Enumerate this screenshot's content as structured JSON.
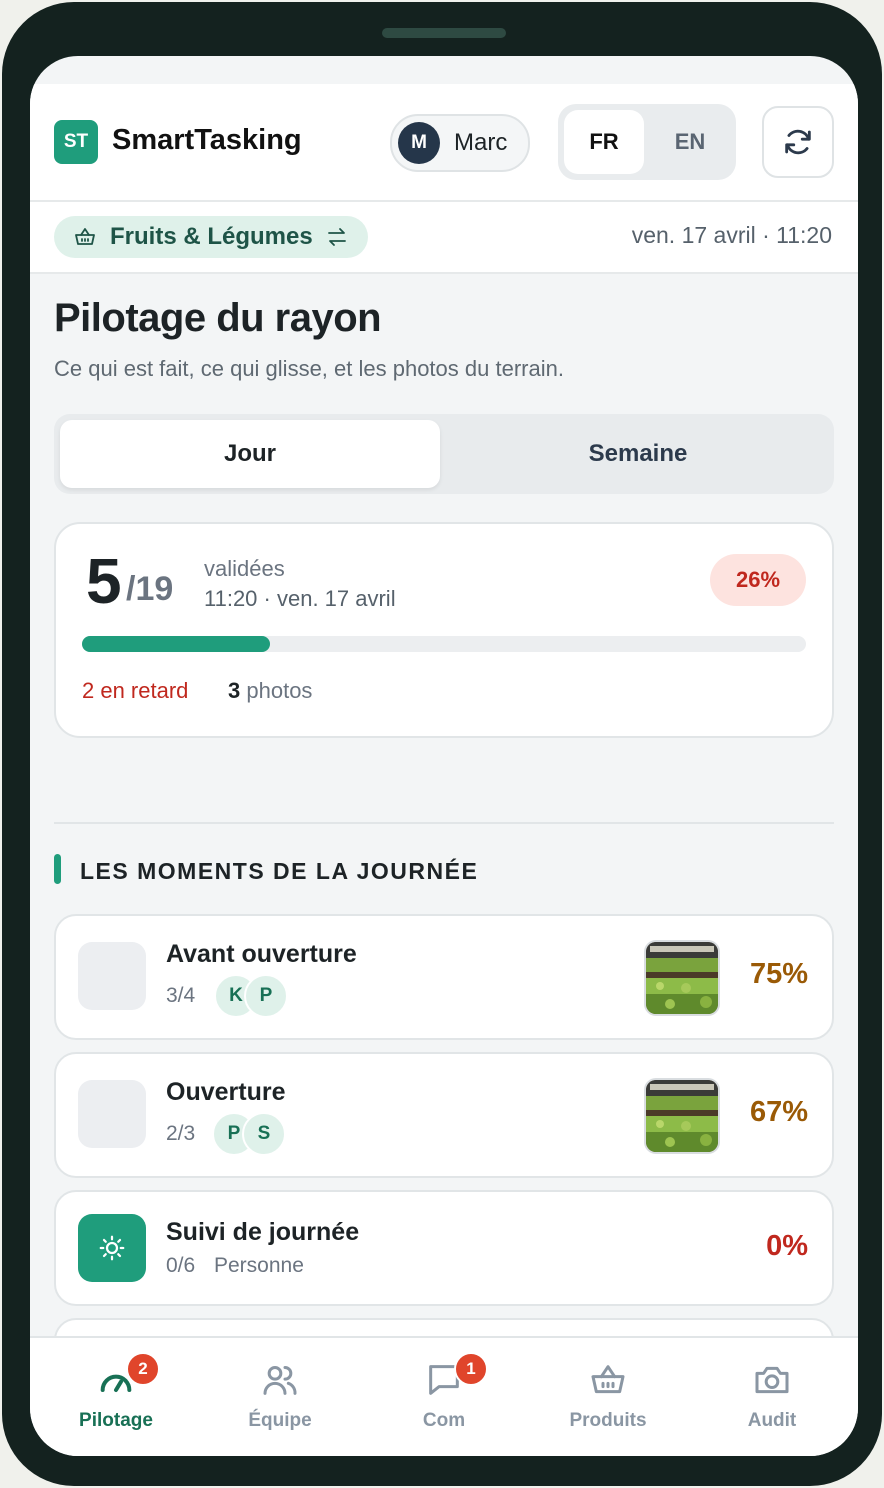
{
  "app": {
    "logo_text": "ST",
    "title": "SmartTasking"
  },
  "user": {
    "initial": "M",
    "name": "Marc"
  },
  "language": {
    "options": [
      "FR",
      "EN"
    ],
    "selected": "FR"
  },
  "department": {
    "name": "Fruits & Légumes"
  },
  "datetime": "ven. 17 avril · 11:20",
  "page": {
    "title": "Pilotage du rayon",
    "subtitle": "Ce qui est fait, ce qui glisse, et les photos du terrain."
  },
  "period_tabs": {
    "options": [
      "Jour",
      "Semaine"
    ],
    "selected": "Jour"
  },
  "summary": {
    "done": "5",
    "total": "/19",
    "status_label": "validées",
    "timestamp": "11:20 · ven. 17 avril",
    "percent_label": "26%",
    "progress_fraction": 0.26,
    "late_label": "2 en retard",
    "photos_count": "3",
    "photos_label": "photos"
  },
  "section": {
    "title": "LES MOMENTS DE LA JOURNÉE"
  },
  "moments": [
    {
      "title": "Avant ouverture",
      "count": "3/4",
      "initials": [
        "K",
        "P"
      ],
      "percent": "75%",
      "has_photo": true,
      "color": "#9a5a06"
    },
    {
      "title": "Ouverture",
      "count": "2/3",
      "initials": [
        "P",
        "S"
      ],
      "percent": "67%",
      "has_photo": true,
      "color": "#9a5a06"
    },
    {
      "title": "Suivi de journée",
      "count": "0/6",
      "assignee": "Personne",
      "percent": "0%",
      "has_photo": false,
      "icon": "sun-icon",
      "color": "#c0281e"
    }
  ],
  "nav": [
    {
      "label": "Pilotage",
      "icon": "gauge-icon",
      "badge": "2",
      "active": true
    },
    {
      "label": "Équipe",
      "icon": "users-icon"
    },
    {
      "label": "Com",
      "icon": "message-icon",
      "badge": "1"
    },
    {
      "label": "Produits",
      "icon": "basket-icon"
    },
    {
      "label": "Audit",
      "icon": "camera-icon"
    }
  ],
  "colors": {
    "accent": "#1f9d7c",
    "danger": "#c0281e",
    "warning": "#9a5a06",
    "badge": "#e0452b"
  }
}
